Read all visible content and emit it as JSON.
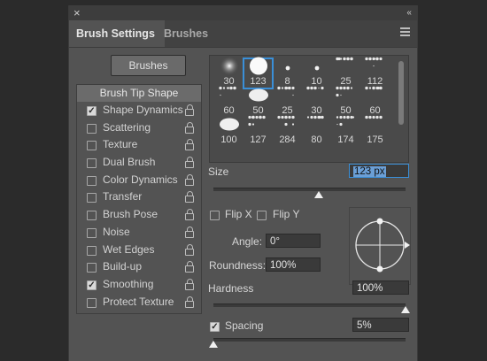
{
  "panel": {
    "close_glyph": "×",
    "collapse_glyph": "‹‹",
    "tabs": [
      {
        "label": "Brush Settings",
        "active": true
      },
      {
        "label": "Brushes",
        "active": false
      }
    ]
  },
  "left": {
    "brushes_button": "Brushes",
    "tip_shape": "Brush Tip Shape",
    "options": [
      {
        "label": "Shape Dynamics",
        "checked": true
      },
      {
        "label": "Scattering",
        "checked": false
      },
      {
        "label": "Texture",
        "checked": false
      },
      {
        "label": "Dual Brush",
        "checked": false
      },
      {
        "label": "Color Dynamics",
        "checked": false
      },
      {
        "label": "Transfer",
        "checked": false
      },
      {
        "label": "Brush Pose",
        "checked": false
      },
      {
        "label": "Noise",
        "checked": false
      },
      {
        "label": "Wet Edges",
        "checked": false
      },
      {
        "label": "Build-up",
        "checked": false
      },
      {
        "label": "Smoothing",
        "checked": true
      },
      {
        "label": "Protect Texture",
        "checked": false
      }
    ]
  },
  "presets": [
    {
      "size": "30",
      "tip": "soft"
    },
    {
      "size": "123",
      "tip": "hard",
      "selected": true
    },
    {
      "size": "8",
      "tip": "dot"
    },
    {
      "size": "10",
      "tip": "dot"
    },
    {
      "size": "25",
      "tip": "spatter"
    },
    {
      "size": "112",
      "tip": "spatter"
    },
    {
      "size": "60",
      "tip": "spatter"
    },
    {
      "size": "50",
      "tip": "blob"
    },
    {
      "size": "25",
      "tip": "spatter"
    },
    {
      "size": "30",
      "tip": "spatter"
    },
    {
      "size": "50",
      "tip": "spatter"
    },
    {
      "size": "60",
      "tip": "spatter"
    },
    {
      "size": "100",
      "tip": "blob"
    },
    {
      "size": "127",
      "tip": "spatter"
    },
    {
      "size": "284",
      "tip": "spatter"
    },
    {
      "size": "80",
      "tip": "spatter"
    },
    {
      "size": "174",
      "tip": "spatter"
    },
    {
      "size": "175",
      "tip": "spatter"
    }
  ],
  "controls": {
    "size_label": "Size",
    "size_value_num": "123",
    "size_value_unit": " px",
    "size_fraction": 0.55,
    "flip_x": "Flip X",
    "flip_y": "Flip Y",
    "angle_label": "Angle:",
    "angle_value": "0°",
    "roundness_label": "Roundness:",
    "roundness_value": "100%",
    "hardness_label": "Hardness",
    "hardness_value": "100%",
    "hardness_fraction": 1.0,
    "spacing_label": "Spacing",
    "spacing_value": "5%",
    "spacing_checked": true,
    "spacing_fraction": 0.0
  },
  "colors": {
    "selection": "#3a8fd8",
    "panel": "#535353"
  }
}
